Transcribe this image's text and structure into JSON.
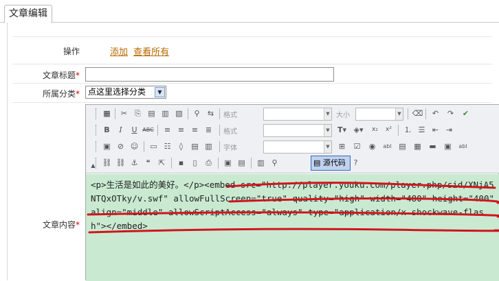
{
  "tab": {
    "label": "文章编辑"
  },
  "form": {
    "operate": {
      "label": "操作",
      "links": [
        "添加",
        "查看所有"
      ]
    },
    "title": {
      "label": "文章标题",
      "required": "*",
      "value": ""
    },
    "category": {
      "label": "所属分类",
      "required": "*",
      "selected": "点这里选择分类"
    },
    "content": {
      "label": "文章内容",
      "required": "*"
    }
  },
  "toolbar": {
    "format_label": "格式",
    "size_label": "大小",
    "font_label": "字体",
    "source_label": "源代码"
  },
  "editor": {
    "code": "<p>生活是如此的美好。</p><embed src=\"http://player.youku.com/player.php/sid/XNjA5NTQxOTky/v.swf\" allowFullScreen=\"true\" quality=\"high\" width=\"480\" height=\"400\" align=\"middle\" allowScriptAccess=\"always\" type=\"application/x-shockwave-flash\"></embed>"
  },
  "colors": {
    "annotation": "#d0141e",
    "editor_bg": "#c9ead1",
    "link": "#b86a00",
    "required": "#d00000"
  }
}
